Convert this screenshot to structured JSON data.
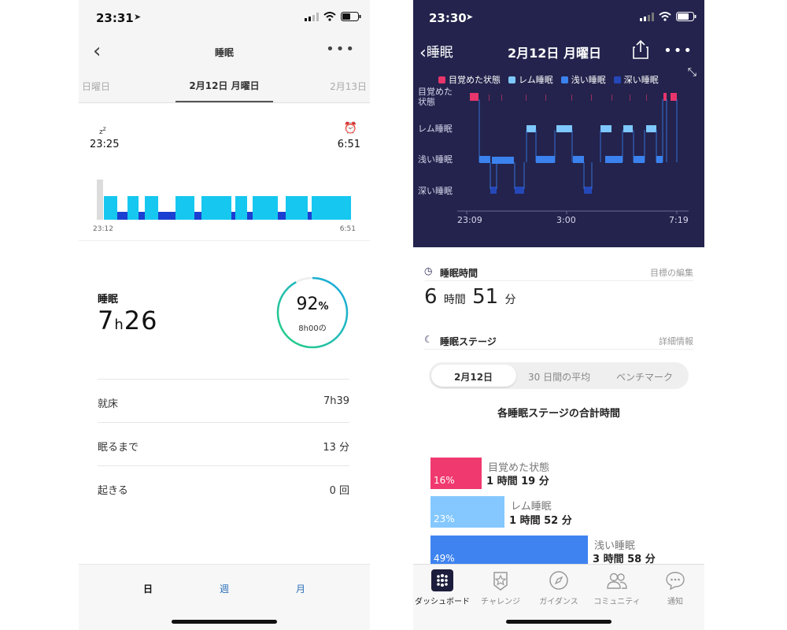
{
  "left": {
    "status_time": "23:31",
    "nav": {
      "title": "睡眠"
    },
    "dates": {
      "prev": "日曜日",
      "current": "2月12日 月曜日",
      "next": "2月13日"
    },
    "chart": {
      "start_time": "23:25",
      "end_time": "6:51",
      "axis_start": "23:12",
      "axis_end": "6:51",
      "colors": {
        "light": "#16c7f0",
        "dark": "#1a3fd1",
        "awake": "#dddddd"
      }
    },
    "summary": {
      "label": "睡眠",
      "hours": "7",
      "h_unit": "h",
      "minutes": "26",
      "percent": "92",
      "percent_sign": "%",
      "percent_value": 92,
      "goal": "8h00の"
    },
    "rows": [
      {
        "label": "就床",
        "value": "7h39"
      },
      {
        "label": "眠るまで",
        "value": "13 分"
      },
      {
        "label": "起きる",
        "value": "0 回"
      }
    ],
    "tabs": [
      {
        "label": "日",
        "active": true
      },
      {
        "label": "週",
        "active": false
      },
      {
        "label": "月",
        "active": false
      }
    ]
  },
  "right": {
    "status_time": "23:30",
    "nav": {
      "back": "睡眠",
      "title": "2月12日 月曜日"
    },
    "legend": [
      {
        "label": "目覚めた状態",
        "color": "#e8356b"
      },
      {
        "label": "レム睡眠",
        "color": "#7ec8ff"
      },
      {
        "label": "浅い睡眠",
        "color": "#3b82ee"
      },
      {
        "label": "深い睡眠",
        "color": "#2547b8"
      }
    ],
    "stage_labels": [
      "目覚めた\n状態",
      "レム睡眠",
      "浅い睡眠",
      "深い睡眠"
    ],
    "x_axis": {
      "start": "23:09",
      "mid": "3:00",
      "end": "7:19"
    },
    "sleep_time": {
      "label": "睡眠時間",
      "action": "目標の編集",
      "hours": "6",
      "h_unit": "時間",
      "minutes": "51",
      "m_unit": "分"
    },
    "stages": {
      "label": "睡眠ステージ",
      "action": "詳細情報",
      "segments": [
        "2月12日",
        "30 日間の平均",
        "ベンチマーク"
      ],
      "title": "各睡眠ステージの合計時間",
      "items": [
        {
          "name": "目覚めた状態",
          "pct": "16%",
          "duration": "1 時間 19 分",
          "value": 16,
          "color": "#f0396f"
        },
        {
          "name": "レム睡眠",
          "pct": "23%",
          "duration": "1 時間 52 分",
          "value": 23,
          "color": "#84c8ff"
        },
        {
          "name": "浅い睡眠",
          "pct": "49%",
          "duration": "3 時間 58 分",
          "value": 49,
          "color": "#3f83f0"
        }
      ]
    },
    "tabs": [
      {
        "label": "ダッシュボード",
        "icon": "dashboard-icon",
        "active": true
      },
      {
        "label": "チャレンジ",
        "icon": "star-badge-icon",
        "active": false
      },
      {
        "label": "ガイダンス",
        "icon": "compass-icon",
        "active": false
      },
      {
        "label": "コミュニティ",
        "icon": "people-icon",
        "active": false
      },
      {
        "label": "通知",
        "icon": "chat-bubble-icon",
        "active": false
      }
    ]
  }
}
